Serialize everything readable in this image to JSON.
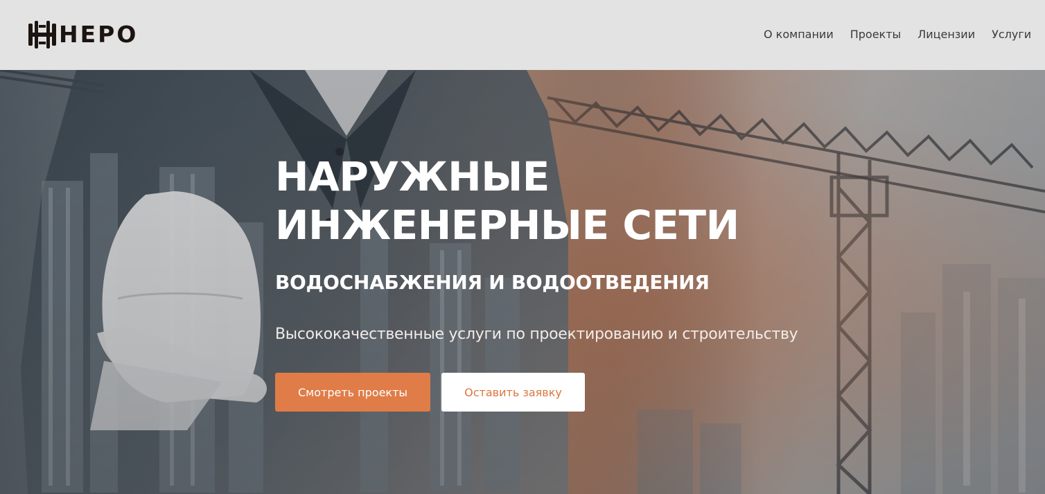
{
  "header": {
    "logo_text": "НЕРО",
    "nav": [
      {
        "label": "О компании"
      },
      {
        "label": "Проекты"
      },
      {
        "label": "Лицензии"
      },
      {
        "label": "Услуги"
      }
    ]
  },
  "hero": {
    "title_line1": "НАРУЖНЫЕ",
    "title_line2": "ИНЖЕНЕРНЫЕ СЕТИ",
    "subtitle": "ВОДОСНАБЖЕНИЯ И ВОДООТВЕДЕНИЯ",
    "tagline": "Высококачественные услуги по проектированию и строительству",
    "primary_button": "Смотреть проекты",
    "secondary_button": "Оставить заявку",
    "background_image": "construction-worker-holding-hard-hat-with-tower-crane",
    "colors": {
      "accent": "#e07c48",
      "secondary_text": "#d9773f",
      "header_bg": "#e3e3e3",
      "logo": "#1c1411"
    }
  }
}
